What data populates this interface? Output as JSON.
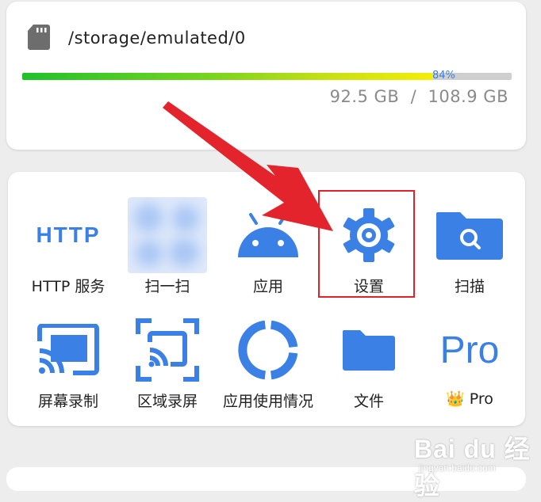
{
  "storage": {
    "path": "/storage/emulated/0",
    "used_fraction": 0.84,
    "percent_label": "84%",
    "size_text": "92.5 GB  /  108.9 GB"
  },
  "tools": {
    "http_service": {
      "icon_text": "HTTP",
      "label": "HTTP 服务",
      "icon": "http-text-icon"
    },
    "scan_qr": {
      "label": "扫一扫",
      "icon": "qr-scan-icon-blurred"
    },
    "apps": {
      "label": "应用",
      "icon": "android-icon"
    },
    "settings": {
      "label": "设置",
      "icon": "gear-icon"
    },
    "scan": {
      "label": "扫描",
      "icon": "folder-search-icon"
    },
    "screen_record": {
      "label": "屏幕录制",
      "icon": "cast-icon"
    },
    "area_record": {
      "label": "区域录屏",
      "icon": "area-cast-icon"
    },
    "app_usage": {
      "label": "应用使用情况",
      "icon": "ring-chart-icon"
    },
    "files": {
      "label": "文件",
      "icon": "folder-icon"
    },
    "pro": {
      "icon_text": "Pro",
      "label": "👑 Pro",
      "icon": "pro-text-icon"
    }
  },
  "watermark": {
    "brand": "Bai du 经验",
    "url": "jingyan.baidu.com"
  },
  "colors": {
    "accent": "#3b80e5",
    "highlight": "#e2212b",
    "bar_start": "#1fc12b",
    "bar_end": "#f4ee06",
    "percent": "#3a7ede"
  }
}
